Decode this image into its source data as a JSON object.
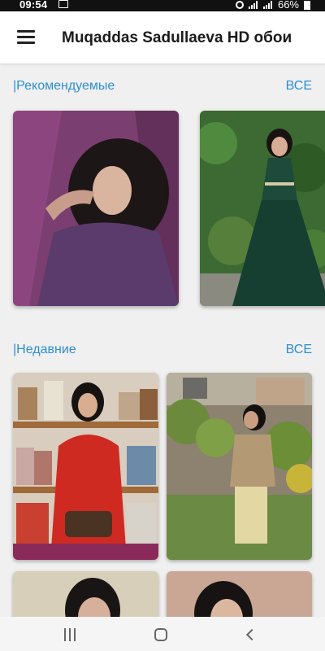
{
  "status_bar": {
    "time": "09:54",
    "battery": "66%"
  },
  "header": {
    "title": "Muqaddas Sadullaeva HD обои",
    "menu_icon": "hamburger-menu-icon"
  },
  "sections": [
    {
      "title": "|Рекомендуемые",
      "see_all": "ВСЕ"
    },
    {
      "title": "|Недавние",
      "see_all": "ВСЕ"
    }
  ],
  "nav_bar": {
    "icons": [
      "recents-icon",
      "home-icon",
      "back-icon"
    ]
  }
}
